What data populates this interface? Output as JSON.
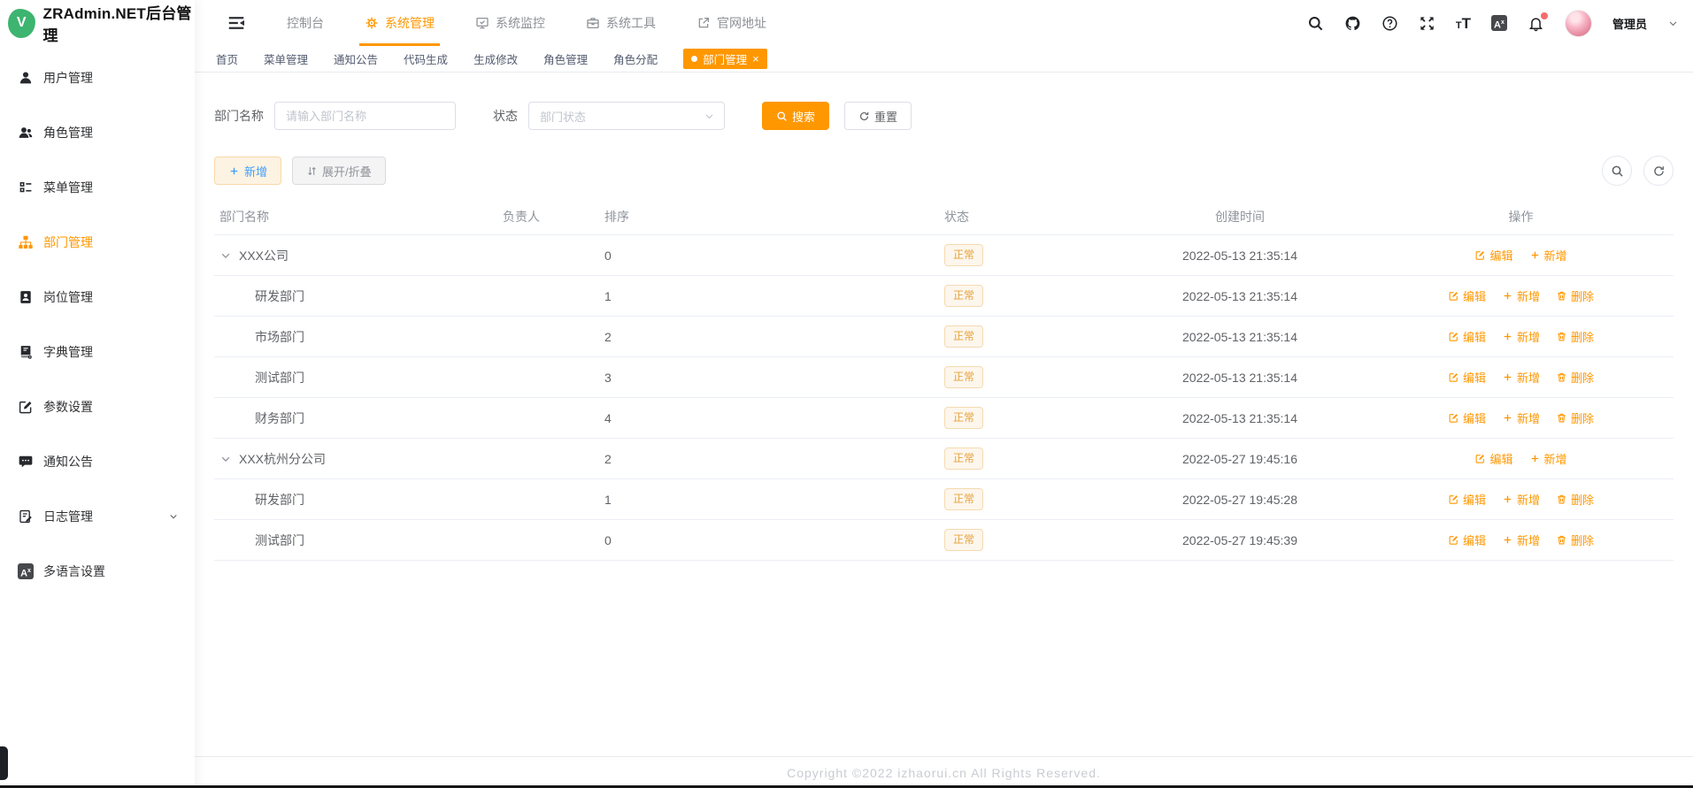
{
  "app": {
    "logo_letter": "V",
    "title": "ZRAdmin.NET后台管理"
  },
  "colors": {
    "primary": "#ff9700",
    "status_text": "#e6a23c",
    "status_bg": "#fdf6ec",
    "status_border": "#f5dab1"
  },
  "topbar": {
    "nav": [
      {
        "label": "控制台",
        "icon": null,
        "active": false
      },
      {
        "label": "系统管理",
        "icon": "gear-icon",
        "active": true
      },
      {
        "label": "系统监控",
        "icon": "monitor-icon",
        "active": false
      },
      {
        "label": "系统工具",
        "icon": "toolbox-icon",
        "active": false
      },
      {
        "label": "官网地址",
        "icon": "external-link-icon",
        "active": false
      }
    ],
    "user_name": "管理员"
  },
  "sidebar": {
    "items": [
      {
        "label": "用户管理",
        "icon": "user-icon",
        "active": false,
        "has_submenu": false
      },
      {
        "label": "角色管理",
        "icon": "users-icon",
        "active": false,
        "has_submenu": false
      },
      {
        "label": "菜单管理",
        "icon": "menu-list-icon",
        "active": false,
        "has_submenu": false
      },
      {
        "label": "部门管理",
        "icon": "org-tree-icon",
        "active": true,
        "has_submenu": false
      },
      {
        "label": "岗位管理",
        "icon": "badge-icon",
        "active": false,
        "has_submenu": false
      },
      {
        "label": "字典管理",
        "icon": "dictionary-icon",
        "active": false,
        "has_submenu": false
      },
      {
        "label": "参数设置",
        "icon": "edit-square-icon",
        "active": false,
        "has_submenu": false
      },
      {
        "label": "通知公告",
        "icon": "announcement-icon",
        "active": false,
        "has_submenu": false
      },
      {
        "label": "日志管理",
        "icon": "log-icon",
        "active": false,
        "has_submenu": true
      },
      {
        "label": "多语言设置",
        "icon": "language-icon",
        "active": false,
        "has_submenu": false
      }
    ]
  },
  "tabs": [
    {
      "label": "首页",
      "active": false
    },
    {
      "label": "菜单管理",
      "active": false
    },
    {
      "label": "通知公告",
      "active": false
    },
    {
      "label": "代码生成",
      "active": false
    },
    {
      "label": "生成修改",
      "active": false
    },
    {
      "label": "角色管理",
      "active": false
    },
    {
      "label": "角色分配",
      "active": false
    },
    {
      "label": "部门管理",
      "active": true,
      "closable": true
    }
  ],
  "filter": {
    "name_label": "部门名称",
    "name_placeholder": "请输入部门名称",
    "status_label": "状态",
    "status_placeholder": "部门状态",
    "search_label": "搜索",
    "reset_label": "重置"
  },
  "toolbar": {
    "add_label": "新增",
    "toggle_label": "展开/折叠"
  },
  "table": {
    "columns": [
      "部门名称",
      "负责人",
      "排序",
      "状态",
      "创建时间",
      "操作"
    ],
    "op_edit": "编辑",
    "op_add": "新增",
    "op_delete": "删除",
    "rows": [
      {
        "name": "XXX公司",
        "level": 0,
        "expandable": true,
        "leader": "",
        "sort": "0",
        "status": "正常",
        "created": "2022-05-13 21:35:14",
        "can_delete": false
      },
      {
        "name": "研发部门",
        "level": 1,
        "expandable": false,
        "leader": "",
        "sort": "1",
        "status": "正常",
        "created": "2022-05-13 21:35:14",
        "can_delete": true
      },
      {
        "name": "市场部门",
        "level": 1,
        "expandable": false,
        "leader": "",
        "sort": "2",
        "status": "正常",
        "created": "2022-05-13 21:35:14",
        "can_delete": true
      },
      {
        "name": "测试部门",
        "level": 1,
        "expandable": false,
        "leader": "",
        "sort": "3",
        "status": "正常",
        "created": "2022-05-13 21:35:14",
        "can_delete": true
      },
      {
        "name": "财务部门",
        "level": 1,
        "expandable": false,
        "leader": "",
        "sort": "4",
        "status": "正常",
        "created": "2022-05-13 21:35:14",
        "can_delete": true
      },
      {
        "name": "XXX杭州分公司",
        "level": 0,
        "expandable": true,
        "leader": "",
        "sort": "2",
        "status": "正常",
        "created": "2022-05-27 19:45:16",
        "can_delete": false
      },
      {
        "name": "研发部门",
        "level": 1,
        "expandable": false,
        "leader": "",
        "sort": "1",
        "status": "正常",
        "created": "2022-05-27 19:45:28",
        "can_delete": true
      },
      {
        "name": "测试部门",
        "level": 1,
        "expandable": false,
        "leader": "",
        "sort": "0",
        "status": "正常",
        "created": "2022-05-27 19:45:39",
        "can_delete": true
      }
    ]
  },
  "footer": {
    "copyright": "Copyright ©2022 izhaorui.cn All Rights Reserved."
  }
}
